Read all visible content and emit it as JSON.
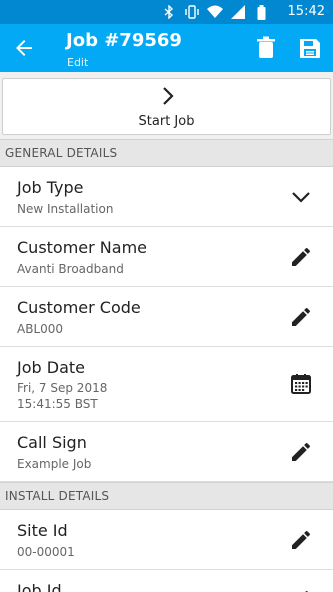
{
  "status": {
    "time": "15:42"
  },
  "appbar": {
    "title": "Job #79569",
    "subtitle": "Edit"
  },
  "start_job": {
    "label": "Start Job"
  },
  "sections": {
    "general": "GENERAL DETAILS",
    "install": "INSTALL DETAILS"
  },
  "fields": {
    "job_type": {
      "label": "Job Type",
      "value": "New Installation"
    },
    "customer_name": {
      "label": "Customer Name",
      "value": "Avanti Broadband"
    },
    "customer_code": {
      "label": "Customer Code",
      "value": "ABL000"
    },
    "job_date": {
      "label": "Job Date",
      "value_line1": "Fri, 7 Sep 2018",
      "value_line2": "15:41:55 BST"
    },
    "call_sign": {
      "label": "Call Sign",
      "value": "Example Job"
    },
    "site_id": {
      "label": "Site Id",
      "value": "00-00001"
    },
    "job_id": {
      "label": "Job Id"
    }
  },
  "colors": {
    "statusbar": "#0288d1",
    "appbar": "#03a9f4"
  }
}
